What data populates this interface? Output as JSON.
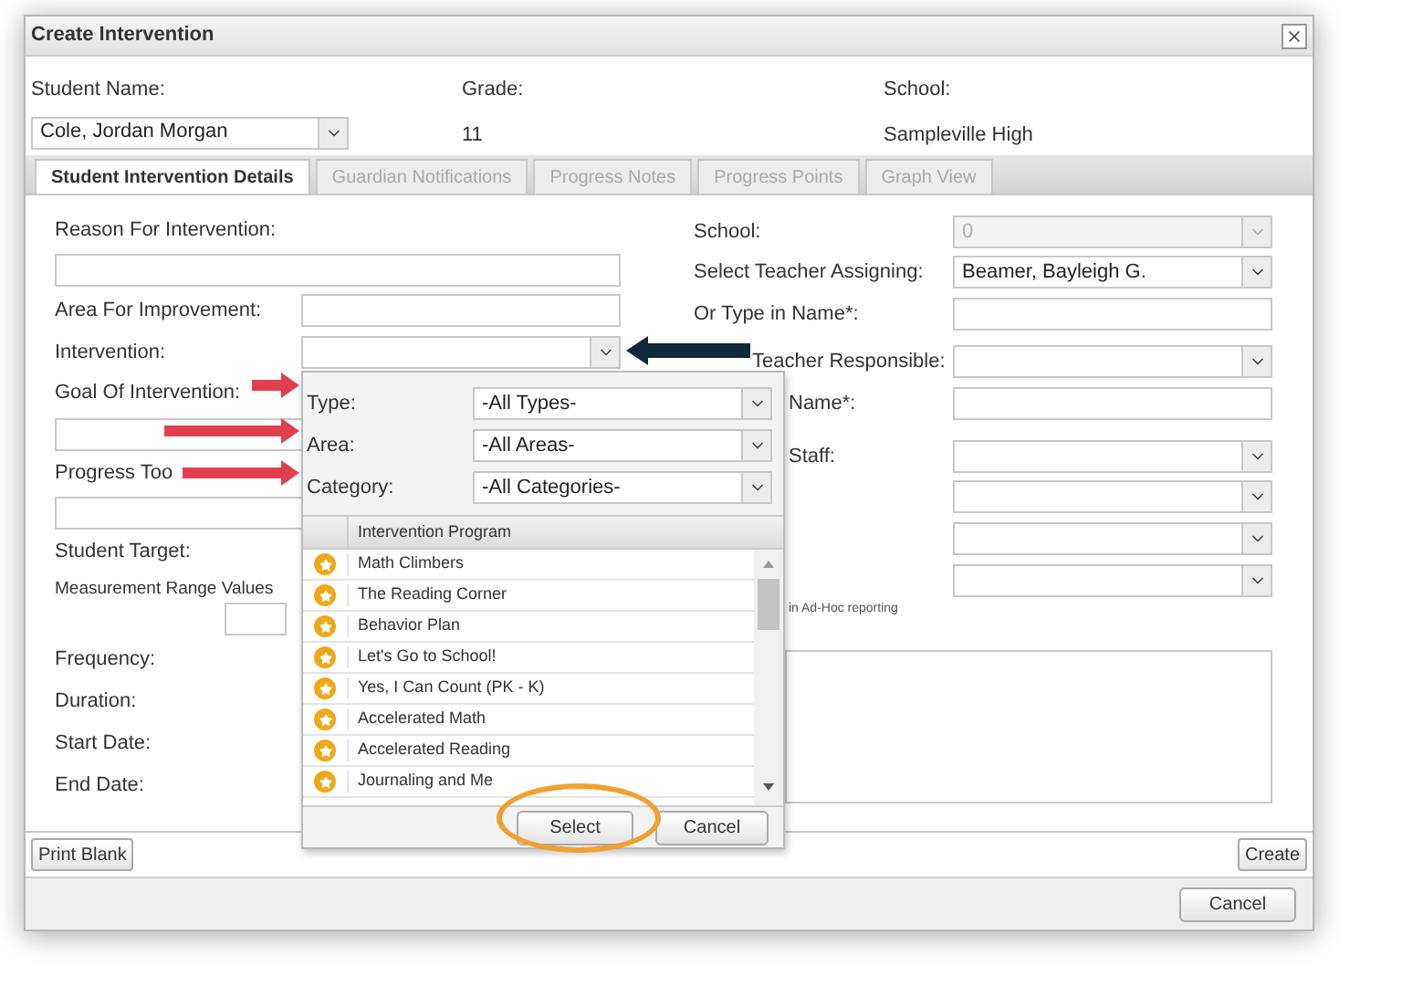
{
  "dialog": {
    "title": "Create Intervention"
  },
  "header": {
    "student_name_label": "Student Name:",
    "student_name": "Cole, Jordan Morgan",
    "grade_label": "Grade:",
    "grade": "11",
    "school_label": "School:",
    "school": "Sampleville High"
  },
  "tabs": [
    {
      "label": "Student Intervention Details",
      "selected": true
    },
    {
      "label": "Guardian Notifications",
      "selected": false
    },
    {
      "label": "Progress Notes",
      "selected": false
    },
    {
      "label": "Progress Points",
      "selected": false
    },
    {
      "label": "Graph View",
      "selected": false
    }
  ],
  "left": {
    "reason_label": "Reason For Intervention:",
    "area_label": "Area For Improvement:",
    "intervention_label": "Intervention:",
    "goal_label": "Goal Of Intervention:",
    "progress_label": "Progress Too",
    "target_label": "Student Target:",
    "range_label": "Measurement Range Values",
    "frequency_label": "Frequency:",
    "duration_label": "Duration:",
    "start_label": "Start Date:",
    "end_label": "End Date:"
  },
  "right": {
    "school_label": "School:",
    "school_value": "0",
    "school_disabled": true,
    "assigning_label": "Select Teacher Assigning:",
    "assigning_value": "Beamer, Bayleigh G.",
    "type_name_label": "Or Type in Name*:",
    "responsible_label": "Teacher Responsible:",
    "name_label": "Name*:",
    "staff_label": "Staff:",
    "adhoc_note": "in Ad-Hoc reporting"
  },
  "popup": {
    "filters": [
      {
        "label": "Type:",
        "value": "-All Types-"
      },
      {
        "label": "Area:",
        "value": "-All Areas-"
      },
      {
        "label": "Category:",
        "value": "-All Categories-"
      }
    ],
    "column": "Intervention Program",
    "programs": [
      "Math Climbers",
      "The Reading Corner",
      "Behavior Plan",
      "Let's Go to School!",
      "Yes, I Can Count (PK - K)",
      "Accelerated Math",
      "Accelerated Reading",
      "Journaling and Me"
    ],
    "select": "Select",
    "cancel": "Cancel"
  },
  "footer": {
    "print_blank": "Print Blank",
    "create": "Create",
    "cancel": "Cancel"
  }
}
